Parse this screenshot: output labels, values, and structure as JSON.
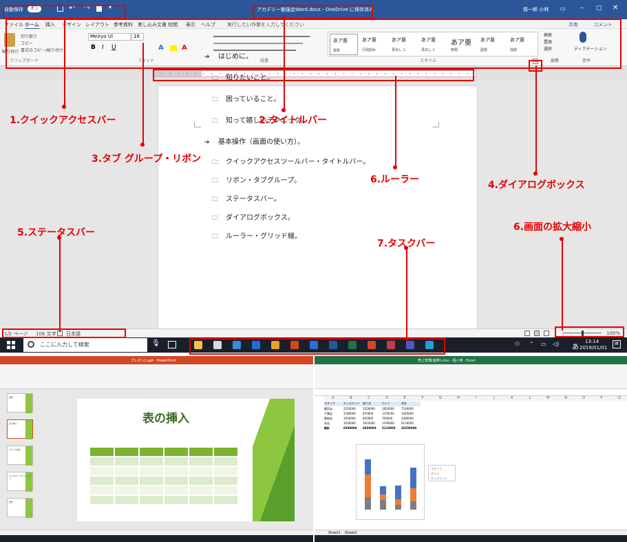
{
  "word": {
    "titlebar": {
      "autosave_label": "自動保存",
      "autosave_state": "オン",
      "document_title": "アカデミー勉強会Word.docx - OneDrive に保存済み",
      "user_name": "情一郎 小林"
    },
    "menu_tabs": [
      "ファイル",
      "ホーム",
      "挿入",
      "デザイン",
      "レイアウト",
      "参考資料",
      "差し込み文書",
      "校閲",
      "表示",
      "ヘルプ"
    ],
    "tell_me": "実行したい作業を入力してください",
    "share_label": "共有",
    "comment_label": "コメント",
    "font_name": "Meiryo UI",
    "font_size": "16",
    "styles": [
      {
        "preview": "あア亜",
        "name": "標準"
      },
      {
        "preview": "あア亜",
        "name": "行間詰め"
      },
      {
        "preview": "あア亜",
        "name": "見出し 1"
      },
      {
        "preview": "あア亜",
        "name": "見出し 2"
      },
      {
        "preview": "あア亜",
        "name": "表題"
      },
      {
        "preview": "あア亜",
        "name": "副題"
      },
      {
        "preview": "あア亜",
        "name": "強調"
      }
    ],
    "ribbon_groups": [
      "クリップボード",
      "フォント",
      "段落",
      "スタイル",
      "編集",
      "音声"
    ],
    "clipboard": {
      "paste": "貼り付け",
      "cut": "切り取り",
      "copy": "コピー",
      "format": "書式のコピー/貼り付け"
    },
    "edit_group": {
      "find": "検索",
      "replace": "置換",
      "select": "選択"
    },
    "dictate": "ディクテーション",
    "outline": [
      {
        "level": 1,
        "text": "はじめに。"
      },
      {
        "level": 2,
        "text": "知りたいこと。"
      },
      {
        "level": 2,
        "text": "困っていること。"
      },
      {
        "level": 2,
        "text": "知って嬉しいテクニック。"
      },
      {
        "level": 1,
        "text": "基本操作（画面の使い方）。"
      },
      {
        "level": 2,
        "text": "クイックアクセスツールバー・タイトルバー。"
      },
      {
        "level": 2,
        "text": "リボン・タブグループ。"
      },
      {
        "level": 2,
        "text": "ステータスバー。"
      },
      {
        "level": 2,
        "text": "ダイアログボックス。"
      },
      {
        "level": 2,
        "text": "ルーラー・グリッド線。"
      }
    ],
    "status": {
      "page": "1/2 ページ",
      "words": "106 文字",
      "language": "日本語",
      "zoom": "100%"
    },
    "taskbar": {
      "search_placeholder": "ここに入力して検索",
      "time": "13:14",
      "date": "2019/01/01",
      "ime": "あ"
    }
  },
  "callouts": [
    {
      "id": "qat",
      "label": "1.クイックアクセスバー"
    },
    {
      "id": "title",
      "label": "2.タイトルバー"
    },
    {
      "id": "ribbon",
      "label": "3.タブ グループ・リボン"
    },
    {
      "id": "dialog",
      "label": "4.ダイアログボックス"
    },
    {
      "id": "status",
      "label": "5.ステータスバー"
    },
    {
      "id": "ruler",
      "label": "6.ルーラー"
    },
    {
      "id": "zoom",
      "label": "6.画面の拡大縮小"
    },
    {
      "id": "taskbar",
      "label": "7.タスクバー"
    }
  ],
  "powerpoint": {
    "title": "プレゼン1.ppt - PowerPoint",
    "slide_heading": "表の挿入",
    "thumb_titles": [
      "講義",
      "表の挿入",
      "グラフの挿入",
      "SmartArt グラフィックス",
      "図形"
    ]
  },
  "excel": {
    "title": "売上管理(抜粋).xlsx - 個人用 - Excel",
    "columns": [
      "A",
      "B",
      "C",
      "D",
      "E",
      "F",
      "G",
      "H",
      "I",
      "J",
      "K",
      "L",
      "M",
      "N",
      "O",
      "P",
      "Q"
    ],
    "headers": [
      "スタッフ",
      "キッズカット",
      "成人式",
      "カット",
      "合計"
    ],
    "rows": [
      [
        "横浜店",
        "2250000",
        "3229000",
        "1850000",
        "7329000"
      ],
      [
        "千葉店",
        "1180000",
        "870000",
        "1370000",
        "3420000"
      ],
      [
        "都筑店",
        "1930000",
        "850000",
        "700000",
        "3480000"
      ],
      [
        "本店",
        "3030000",
        "1910000",
        "1190000",
        "6130000"
      ],
      [
        "総計",
        "8390000",
        "6859000",
        "5110000",
        "20359000"
      ]
    ],
    "legend": [
      "スタッフ",
      "成人式",
      "キッズカット"
    ],
    "sheet_tabs": [
      "Sheet1",
      "Sheet2"
    ]
  },
  "colors": {
    "word_blue": "#2b579a",
    "ppt_orange": "#d24726",
    "excel_green": "#217346",
    "callout_red": "#e60000",
    "slide_green": "#8dc63f"
  }
}
